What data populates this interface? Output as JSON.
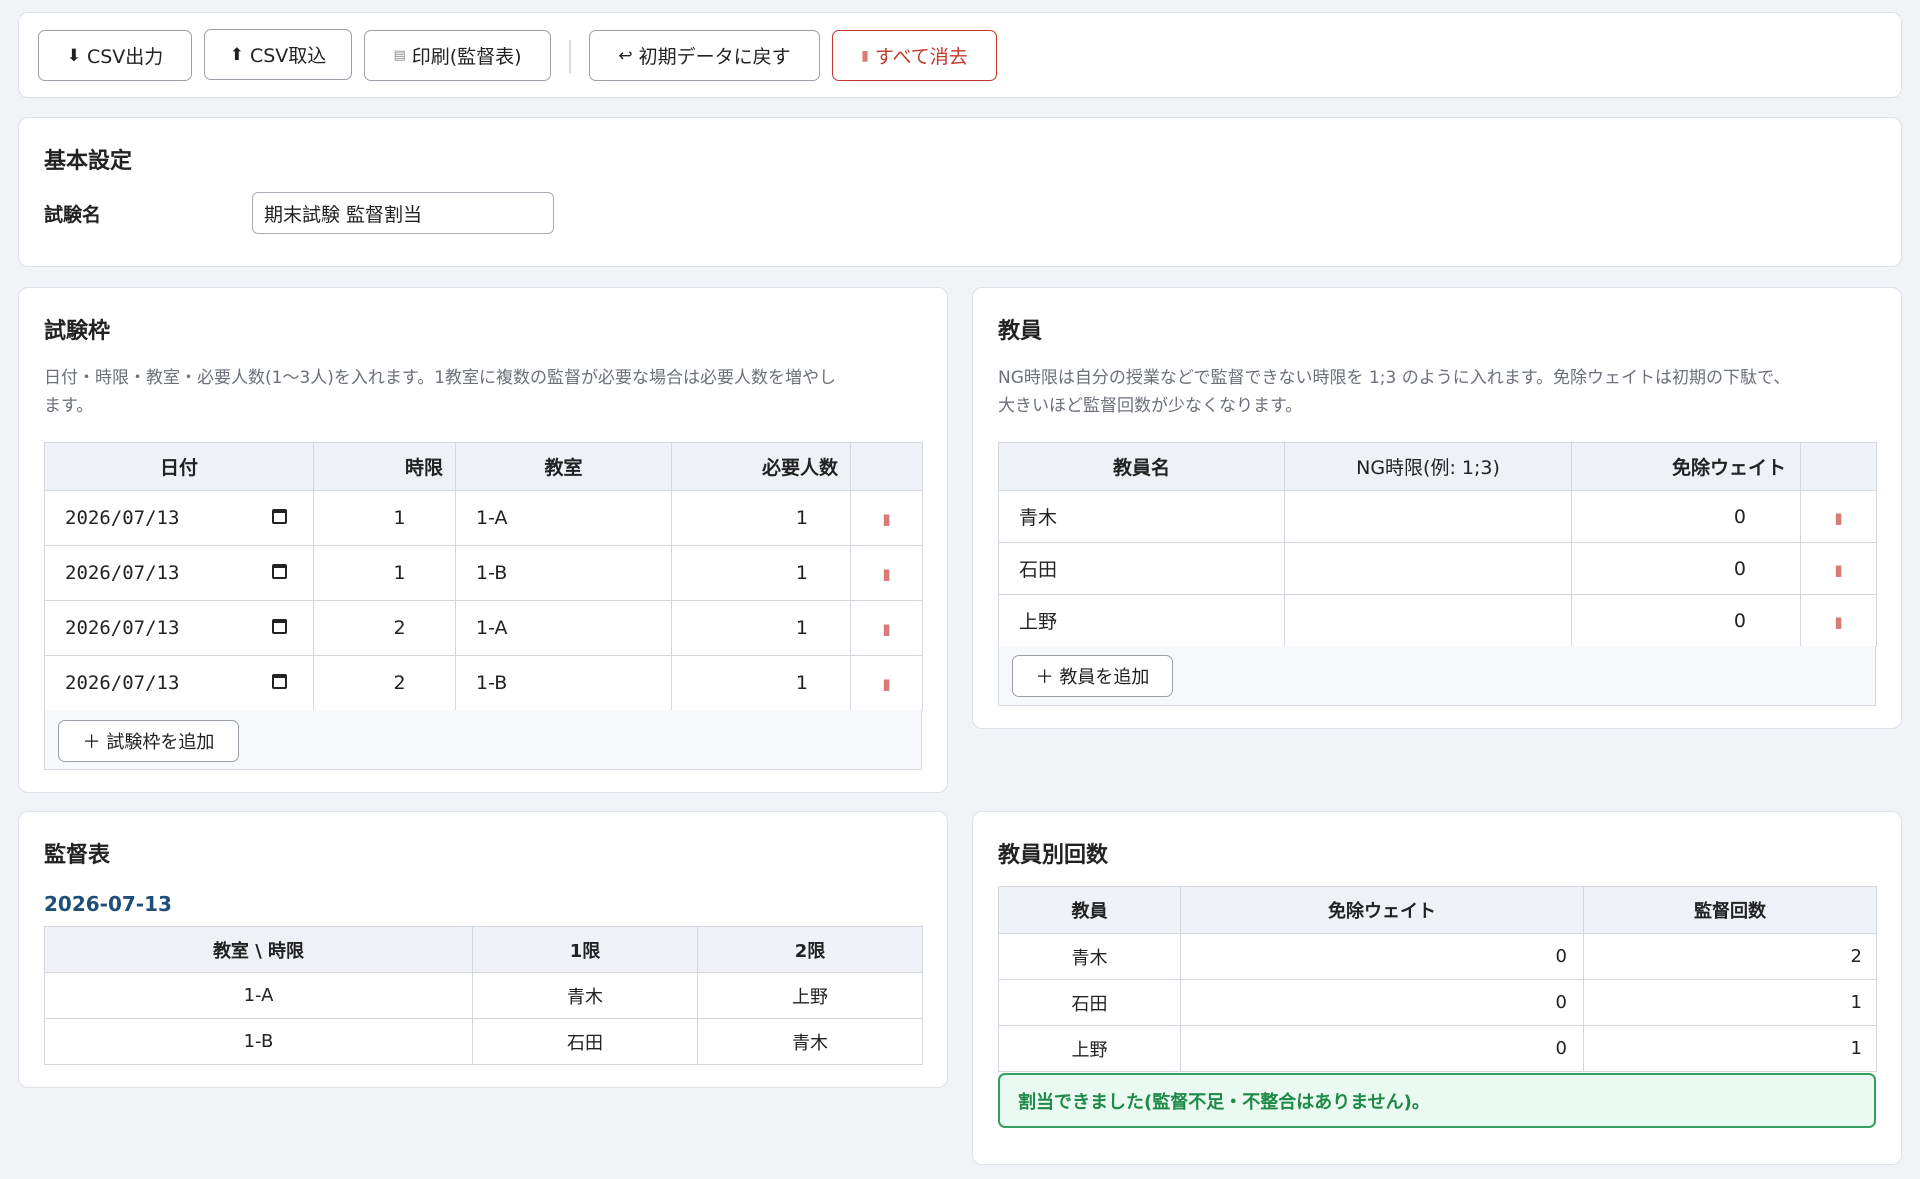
{
  "toolbar": {
    "csv_export": "CSV出力",
    "csv_import": "CSV取込",
    "print": "印刷(監督表)",
    "reset": "初期データに戻す",
    "clear_all": "すべて消去"
  },
  "basic": {
    "title": "基本設定",
    "exam_name_label": "試験名",
    "exam_name_value": "期末試験 監督割当"
  },
  "slots": {
    "title": "試験枠",
    "desc_line1": "日付・時限・教室・必要人数(1〜3人)を入れます。1教室に複数の監督が必要な場合は必要人数を増やし",
    "desc_line2": "ます。",
    "headers": {
      "date": "日付",
      "period": "時限",
      "room": "教室",
      "required": "必要人数"
    },
    "rows": [
      {
        "date": "2026/07/13",
        "period": "1",
        "room": "1-A",
        "required": "1"
      },
      {
        "date": "2026/07/13",
        "period": "1",
        "room": "1-B",
        "required": "1"
      },
      {
        "date": "2026/07/13",
        "period": "2",
        "room": "1-A",
        "required": "1"
      },
      {
        "date": "2026/07/13",
        "period": "2",
        "room": "1-B",
        "required": "1"
      }
    ],
    "add_label": "＋ 試験枠を追加"
  },
  "teachers": {
    "title": "教員",
    "desc_line1": "NG時限は自分の授業などで監督できない時限を 1;3 のように入れます。免除ウェイトは初期の下駄で、",
    "desc_line2": "大きいほど監督回数が少なくなります。",
    "headers": {
      "name": "教員名",
      "ng": "NG時限(例: 1;3)",
      "weight": "免除ウェイト"
    },
    "rows": [
      {
        "name": "青木",
        "ng": "",
        "weight": "0"
      },
      {
        "name": "石田",
        "ng": "",
        "weight": "0"
      },
      {
        "name": "上野",
        "ng": "",
        "weight": "0"
      }
    ],
    "add_label": "＋ 教員を追加"
  },
  "schedule": {
    "title": "監督表",
    "date": "2026-07-13",
    "headers": {
      "corner": "教室 \\ 時限",
      "p1": "1限",
      "p2": "2限"
    },
    "rows": [
      {
        "room": "1-A",
        "p1": "青木",
        "p2": "上野"
      },
      {
        "room": "1-B",
        "p1": "石田",
        "p2": "青木"
      }
    ]
  },
  "counts": {
    "title": "教員別回数",
    "headers": {
      "teacher": "教員",
      "weight": "免除ウェイト",
      "count": "監督回数"
    },
    "rows": [
      {
        "teacher": "青木",
        "weight": "0",
        "count": "2"
      },
      {
        "teacher": "石田",
        "weight": "0",
        "count": "1"
      },
      {
        "teacher": "上野",
        "weight": "0",
        "count": "1"
      }
    ],
    "status": "割当できました(監督不足・不整合はありません)。"
  },
  "colors": {
    "danger": "#c0392b",
    "success": "#1e8a48",
    "date_heading": "#1f4e79",
    "trash": "#d97a77"
  },
  "icons": [
    "download-icon",
    "upload-icon",
    "printer-icon",
    "undo-icon",
    "trash-icon",
    "calendar-icon",
    "plus-icon"
  ]
}
